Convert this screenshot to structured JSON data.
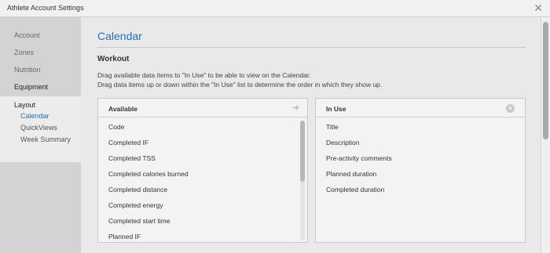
{
  "window": {
    "title": "Athlete Account Settings",
    "close_icon": "close-icon"
  },
  "sidebar": {
    "items": [
      {
        "label": "Account"
      },
      {
        "label": "Zones"
      },
      {
        "label": "Nutrition"
      },
      {
        "label": "Equipment"
      },
      {
        "label": "Layout"
      }
    ],
    "layout_subitems": [
      {
        "label": "Calendar",
        "active": true
      },
      {
        "label": "QuickViews",
        "active": false
      },
      {
        "label": "Week Summary",
        "active": false
      }
    ]
  },
  "main": {
    "title": "Calendar",
    "section": "Workout",
    "description": [
      "Drag available data items to \"In Use\" to be able to view on the Calendar.",
      "Drag data items up or down within the \"In Use\" list to determine the order in which they show up."
    ],
    "available": {
      "header": "Available",
      "icon": "arrow-right-icon",
      "items": [
        "Code",
        "Completed IF",
        "Completed TSS",
        "Completed calories burned",
        "Completed distance",
        "Completed energy",
        "Completed start time",
        "Planned IF"
      ]
    },
    "in_use": {
      "header": "In Use",
      "icon": "clear-icon",
      "items": [
        "Title",
        "Description",
        "Pre-activity comments",
        "Planned duration",
        "Completed duration"
      ]
    }
  },
  "colors": {
    "accent": "#2a6fb0",
    "sidebar_bg": "#d3d3d3",
    "panel_bg": "#f3f3f3"
  }
}
